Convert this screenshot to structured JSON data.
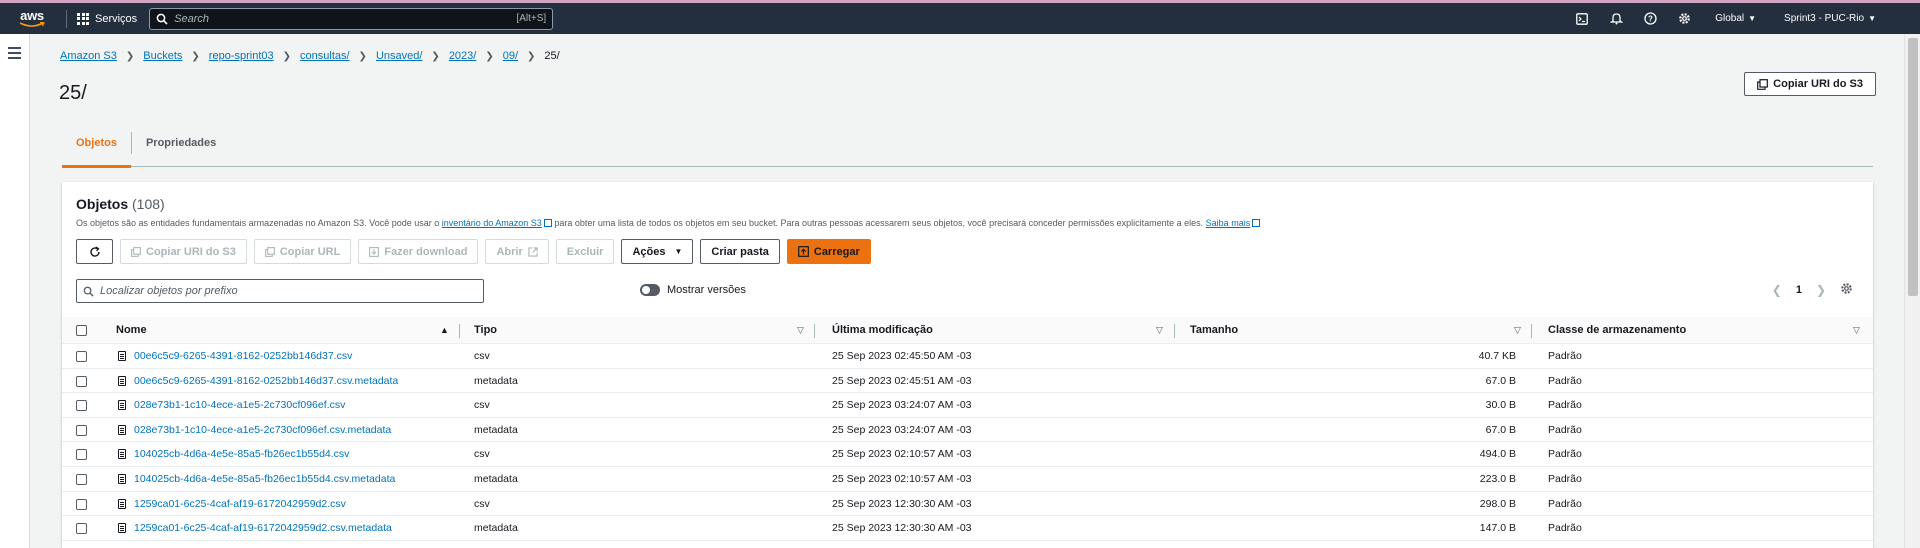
{
  "topbar": {
    "logo": "aws",
    "services_label": "Serviços",
    "search_placeholder": "Search",
    "search_hint": "[Alt+S]",
    "region_label": "Global",
    "account_label": "Sprint3 - PUC-Rio",
    "icons": [
      "cloudshell-icon",
      "bell-icon",
      "help-icon",
      "gear-icon"
    ]
  },
  "breadcrumb": {
    "items": [
      "Amazon S3",
      "Buckets",
      "repo-sprint03",
      "consultas/",
      "Unsaved/",
      "2023/",
      "09/"
    ],
    "current": "25/"
  },
  "page": {
    "title": "25/",
    "copy_uri_label": "Copiar URI do S3"
  },
  "tabs": [
    "Objetos",
    "Propriedades"
  ],
  "objects_panel": {
    "title": "Objetos",
    "count": "(108)",
    "desc_before": "Os objetos são as entidades fundamentais armazenadas no Amazon S3. Você pode usar o ",
    "desc_link1": "inventário do Amazon S3",
    "desc_middle": " para obter uma lista de todos os objetos em seu bucket. Para outras pessoas acessarem seus objetos, você precisará conceder permissões explicitamente a eles. ",
    "desc_link2": "Saiba mais",
    "buttons": {
      "copy_uri": "Copiar URI do S3",
      "copy_url": "Copiar URL",
      "download": "Fazer download",
      "open": "Abrir",
      "delete": "Excluir",
      "actions": "Ações",
      "create_folder": "Criar pasta",
      "upload": "Carregar"
    },
    "filter_placeholder": "Localizar objetos por prefixo",
    "versions_toggle": "Mostrar versões",
    "page_number": "1",
    "columns": [
      "Nome",
      "Tipo",
      "Última modificação",
      "Tamanho",
      "Classe de armazenamento"
    ],
    "rows": [
      {
        "name": "00e6c5c9-6265-4391-8162-0252bb146d37.csv",
        "type": "csv",
        "modified": "25 Sep 2023 02:45:50 AM -03",
        "size": "40.7 KB",
        "class": "Padrão"
      },
      {
        "name": "00e6c5c9-6265-4391-8162-0252bb146d37.csv.metadata",
        "type": "metadata",
        "modified": "25 Sep 2023 02:45:51 AM -03",
        "size": "67.0 B",
        "class": "Padrão"
      },
      {
        "name": "028e73b1-1c10-4ece-a1e5-2c730cf096ef.csv",
        "type": "csv",
        "modified": "25 Sep 2023 03:24:07 AM -03",
        "size": "30.0 B",
        "class": "Padrão"
      },
      {
        "name": "028e73b1-1c10-4ece-a1e5-2c730cf096ef.csv.metadata",
        "type": "metadata",
        "modified": "25 Sep 2023 03:24:07 AM -03",
        "size": "67.0 B",
        "class": "Padrão"
      },
      {
        "name": "104025cb-4d6a-4e5e-85a5-fb26ec1b55d4.csv",
        "type": "csv",
        "modified": "25 Sep 2023 02:10:57 AM -03",
        "size": "494.0 B",
        "class": "Padrão"
      },
      {
        "name": "104025cb-4d6a-4e5e-85a5-fb26ec1b55d4.csv.metadata",
        "type": "metadata",
        "modified": "25 Sep 2023 02:10:57 AM -03",
        "size": "223.0 B",
        "class": "Padrão"
      },
      {
        "name": "1259ca01-6c25-4caf-af19-6172042959d2.csv",
        "type": "csv",
        "modified": "25 Sep 2023 12:30:30 AM -03",
        "size": "298.0 B",
        "class": "Padrão"
      },
      {
        "name": "1259ca01-6c25-4caf-af19-6172042959d2.csv.metadata",
        "type": "metadata",
        "modified": "25 Sep 2023 12:30:30 AM -03",
        "size": "147.0 B",
        "class": "Padrão"
      }
    ]
  }
}
